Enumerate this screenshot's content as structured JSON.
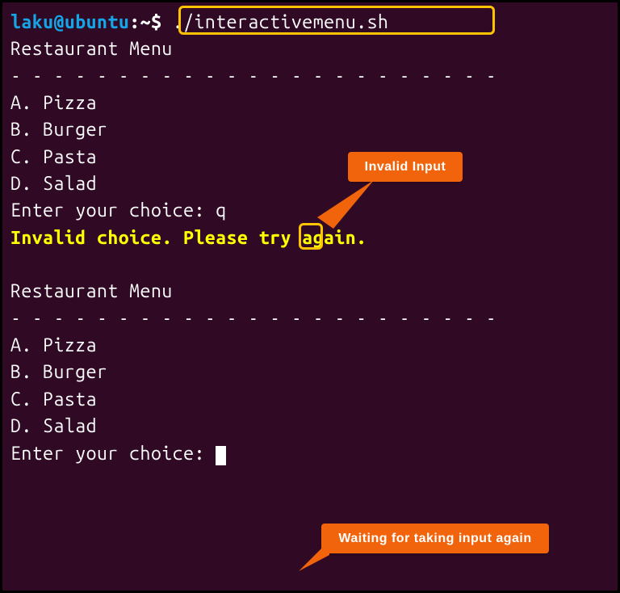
{
  "prompt": {
    "user": "laku",
    "at": "@",
    "host": "ubuntu",
    "colon": ":",
    "path": "~",
    "dollar": "$ ",
    "command": "./interactivemenu.sh"
  },
  "menu": {
    "title": "Restaurant Menu",
    "sepChar": "-",
    "sep": "- - - - - - - - - - - - - - - - - - - - - - -",
    "options": [
      {
        "key": "A",
        "label": "Pizza"
      },
      {
        "key": "B",
        "label": "Burger"
      },
      {
        "key": "C",
        "label": "Pasta"
      },
      {
        "key": "D",
        "label": "Salad"
      }
    ],
    "enterPrompt": "Enter your choice: ",
    "enteredValue": "q",
    "errorMsg": "Invalid choice. Please try again."
  },
  "callouts": {
    "c1": "Invalid Input",
    "c2": "Waiting for taking input again"
  },
  "colors": {
    "bg": "#300a24",
    "text": "#ffffff",
    "promptUserHost": "#15a4e5",
    "errorText": "#ffff00",
    "highlightBorder": "#ffc400",
    "calloutBg": "#f1640c"
  }
}
